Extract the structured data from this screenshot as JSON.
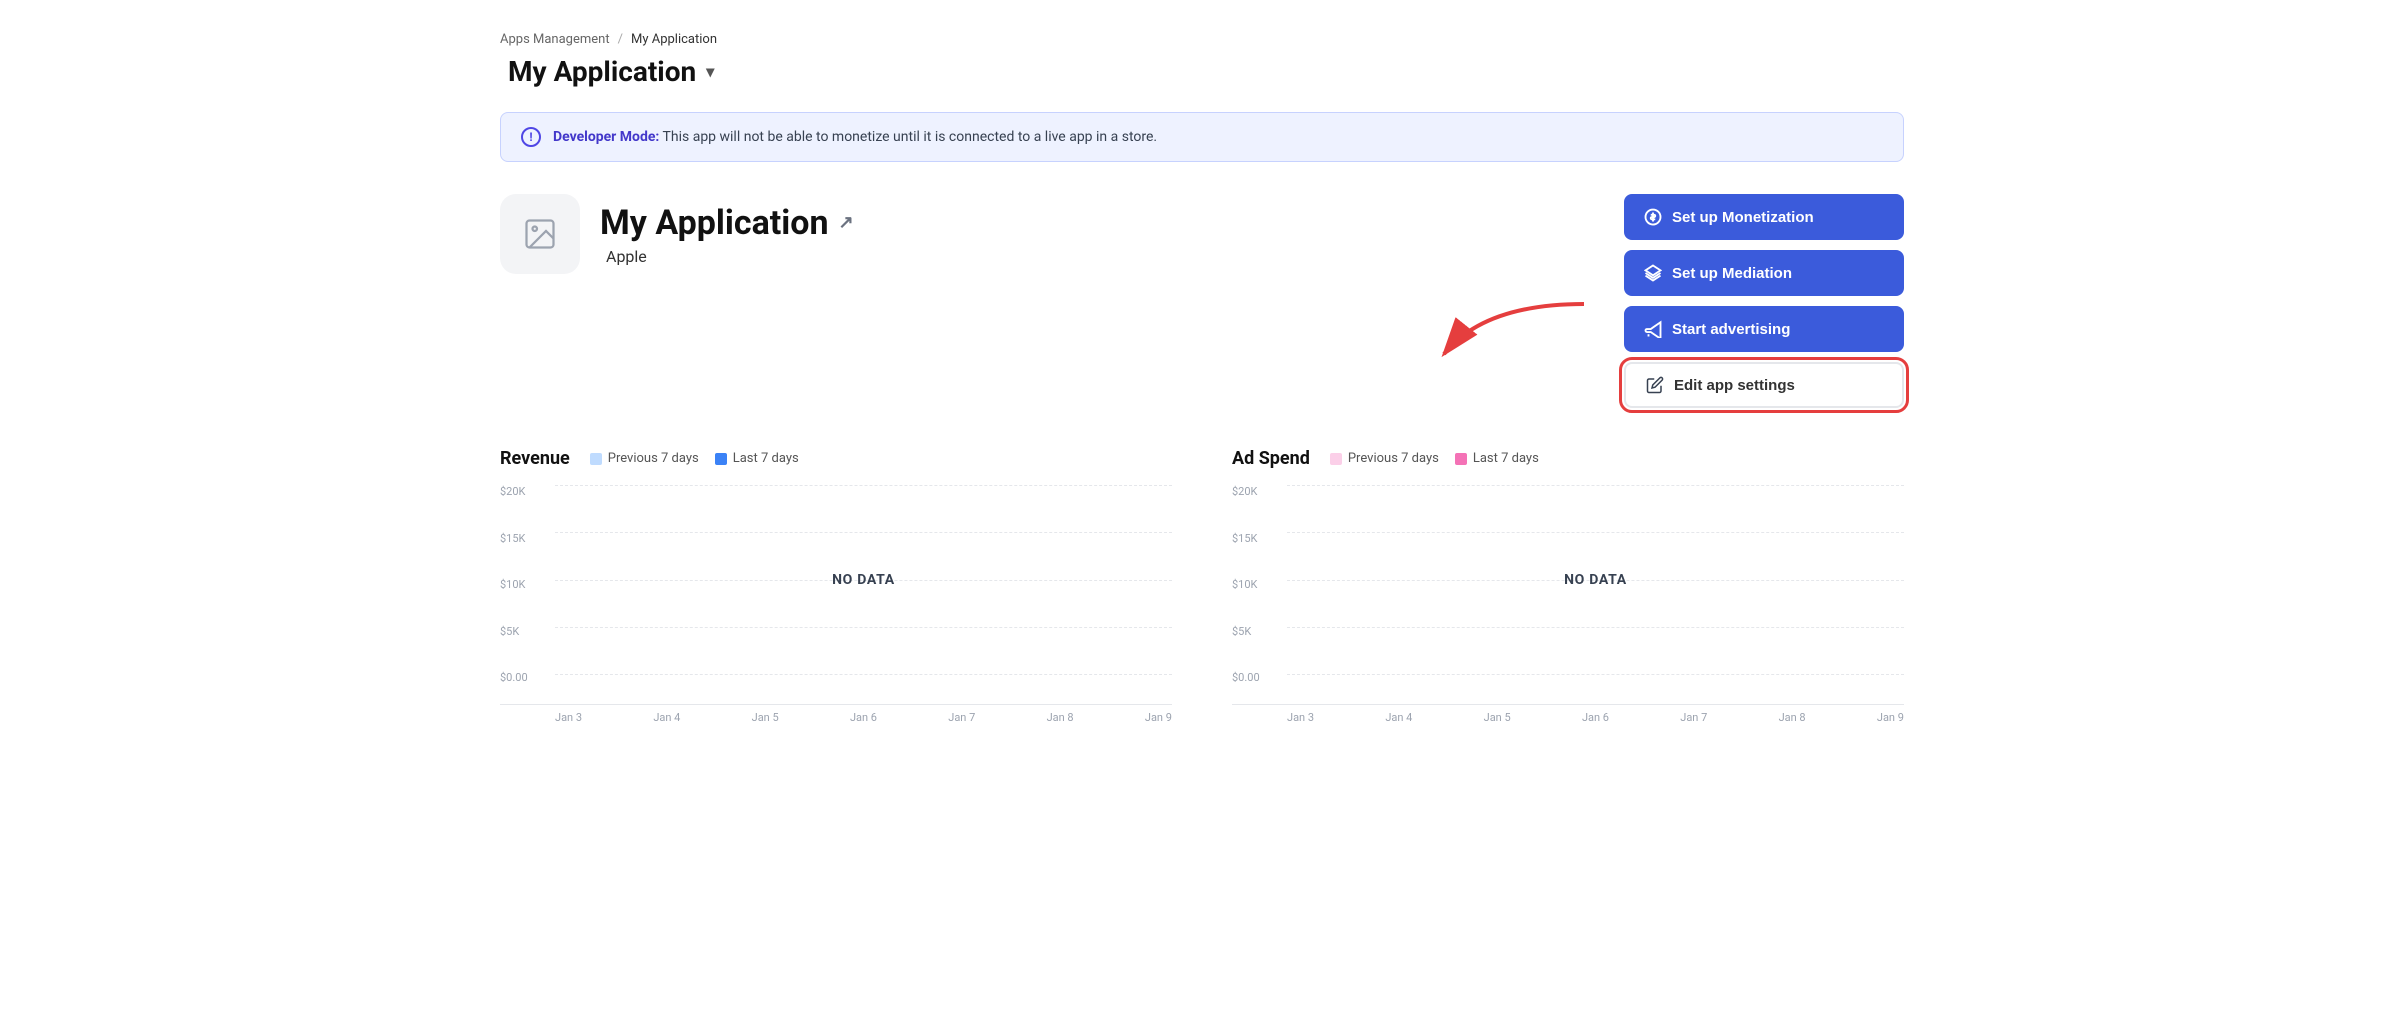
{
  "breadcrumb": {
    "parent": "Apps Management",
    "separator": "/",
    "current": "My Application"
  },
  "page_title": {
    "apple_icon": "",
    "title": "My Application",
    "chevron": "▾"
  },
  "developer_banner": {
    "bold_text": "Developer Mode:",
    "message": " This app will not be able to monetize until it is connected to a live app in a store."
  },
  "app": {
    "name": "My Application",
    "platform": "Apple"
  },
  "buttons": {
    "monetization": "Set up Monetization",
    "mediation": "Set up Mediation",
    "advertising": "Start advertising",
    "edit_settings": "Edit app settings"
  },
  "revenue_chart": {
    "title": "Revenue",
    "legend": {
      "prev": "Previous 7 days",
      "last": "Last 7 days",
      "prev_color": "#bfdbfe",
      "last_color": "#3b82f6"
    },
    "y_labels": [
      "$20K",
      "$15K",
      "$10K",
      "$5K",
      "$0.00"
    ],
    "x_labels": [
      "Jan 3",
      "Jan 4",
      "Jan 5",
      "Jan 6",
      "Jan 7",
      "Jan 8",
      "Jan 9"
    ],
    "no_data": "NO DATA"
  },
  "adspend_chart": {
    "title": "Ad Spend",
    "legend": {
      "prev": "Previous 7 days",
      "last": "Last 7 days",
      "prev_color": "#fbcfe8",
      "last_color": "#f472b6"
    },
    "y_labels": [
      "$20K",
      "$15K",
      "$10K",
      "$5K",
      "$0.00"
    ],
    "x_labels": [
      "Jan 3",
      "Jan 4",
      "Jan 5",
      "Jan 6",
      "Jan 7",
      "Jan 8",
      "Jan 9"
    ],
    "no_data": "NO DATA"
  },
  "icons": {
    "dollar": "$",
    "layers": "⊕",
    "megaphone": "📢",
    "edit": "✏"
  }
}
